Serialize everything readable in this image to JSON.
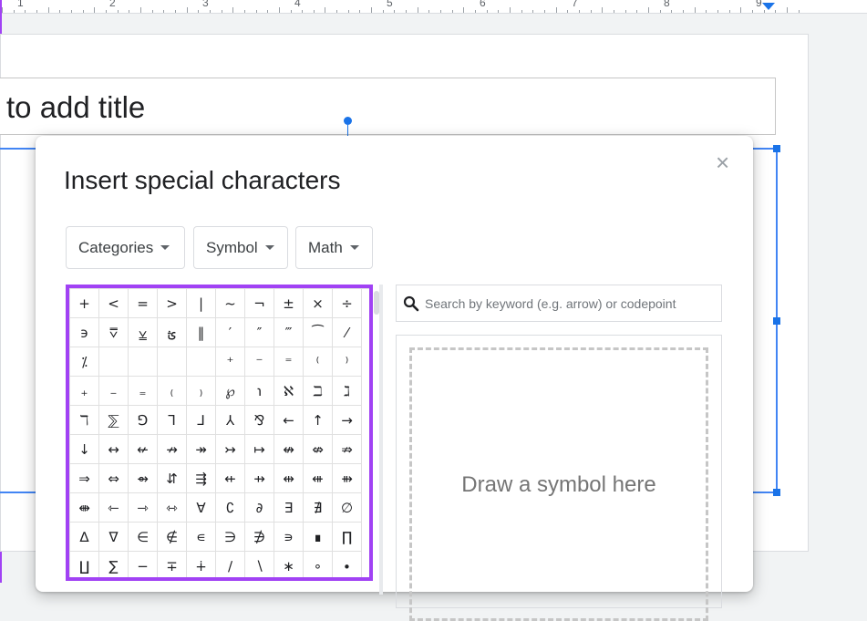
{
  "ruler": {
    "numbers": [
      "1",
      "2",
      "3",
      "4",
      "5",
      "6",
      "7",
      "8",
      "9"
    ]
  },
  "slide": {
    "title_placeholder": "to add title"
  },
  "dialog": {
    "title": "Insert special characters",
    "close_label": "×",
    "dropdowns": {
      "categories": "Categories",
      "symbol": "Symbol",
      "math": "Math"
    },
    "search": {
      "placeholder": "Search by keyword (e.g. arrow) or codepoint"
    },
    "draw_label": "Draw a symbol here",
    "characters": [
      [
        "+",
        "<",
        "=",
        ">",
        "|",
        "~",
        "¬",
        "±",
        "×",
        "÷"
      ],
      [
        "϶",
        "⩢",
        "⩣",
        "ؿ",
        "‖",
        "′",
        "″",
        "‴",
        "⁀",
        "⁄"
      ],
      [
        "⁒",
        "",
        "",
        "",
        "",
        "⁺",
        "⁻",
        "⁼",
        "⁽",
        "⁾"
      ],
      [
        "₊",
        "₋",
        "₌",
        "₍",
        "₎",
        "℘",
        "℩",
        "ℵ",
        "ℶ",
        "ℷ"
      ],
      [
        "ℸ",
        "⅀",
        "⅁",
        "⅂",
        "⅃",
        "⅄",
        "⅋",
        "←",
        "↑",
        "→"
      ],
      [
        "↓",
        "↔",
        "↚",
        "↛",
        "↠",
        "↣",
        "↦",
        "↮",
        "⇎",
        "⇏"
      ],
      [
        "⇒",
        "⇔",
        "⇴",
        "⇵",
        "⇶",
        "⇷",
        "⇸",
        "⇹",
        "⇺",
        "⇻"
      ],
      [
        "⇼",
        "⇽",
        "⇾",
        "⇿",
        "∀",
        "∁",
        "∂",
        "∃",
        "∄",
        "∅"
      ],
      [
        "∆",
        "∇",
        "∈",
        "∉",
        "∊",
        "∋",
        "∌",
        "∍",
        "∎",
        "∏"
      ],
      [
        "∐",
        "∑",
        "−",
        "∓",
        "∔",
        "∕",
        "∖",
        "∗",
        "∘",
        "∙"
      ]
    ]
  },
  "colors": {
    "highlight": "#a142f4",
    "selection": "#1a73e8"
  }
}
